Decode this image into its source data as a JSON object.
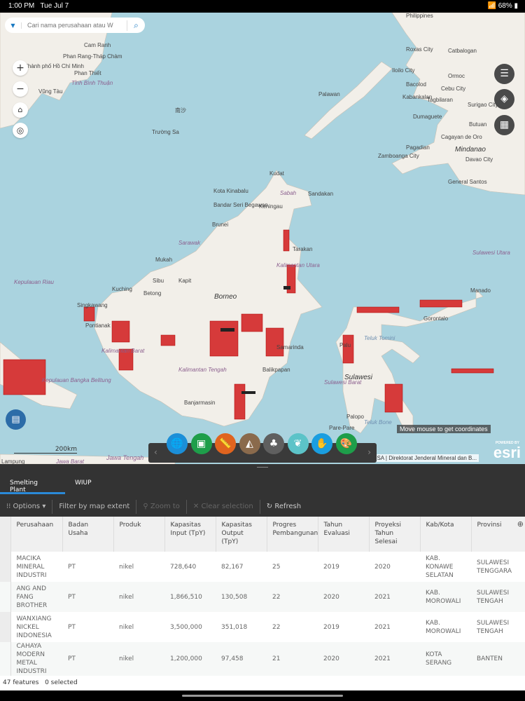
{
  "status": {
    "time": "1:00 PM",
    "date": "Tue Jul 7",
    "battery": "68%"
  },
  "search": {
    "placeholder": "Cari nama perusahaan atau W"
  },
  "map": {
    "labels": {
      "philippines": "Philippines",
      "roxas": "Roxas City",
      "cataloban": "Catbalogan",
      "iloilo": "Iloilo City",
      "bacolod": "Bacolod",
      "cebu": "Cebu City",
      "ormoc": "Ormoc",
      "tagbilaran": "Tagbilaran",
      "surigao": "Surigao City",
      "dumaguete": "Dumaguete",
      "butuan": "Butuan",
      "kabankalan": "Kabankalan",
      "zamboanga": "Zamboanga City",
      "pagadian": "Pagadian",
      "cagayan": "Cagayan de Oro",
      "mindanao": "Mindanao",
      "davao": "Davao City",
      "gensan": "General Santos",
      "palawan": "Palawan",
      "kudat": "Kudat",
      "kk": "Kota Kinabalu",
      "sabah": "Sabah",
      "sandakan": "Sandakan",
      "bsb": "Bandar Seri Begawan",
      "brunei": "Brunei",
      "keningau": "Keningau",
      "tarakan": "Tarakan",
      "mukah": "Mukah",
      "sarawak": "Sarawak",
      "sibu": "Sibu",
      "kapit": "Kapit",
      "borneo": "Borneo",
      "kuching": "Kuching",
      "betong": "Betong",
      "singkawang": "Singkawang",
      "pontianak": "Pontianak",
      "samarinda": "Samarinda",
      "balikpapan": "Balikpapan",
      "banjarmasin": "Banjarmasin",
      "manado": "Manado",
      "gorontalo": "Gorontalo",
      "palu": "Palu",
      "sulawesi": "Sulawesi",
      "parepare": "Pare-Pare",
      "palopo": "Palopo",
      "kepriau": "Kepulauan Riau",
      "camranh": "Cam Ranh",
      "phanrang": "Phan Rang-Tháp Chàm",
      "hcm": "Thành phố Hồ Chí Minh",
      "phanthiet": "Phan Thiết",
      "vungtau": "Vũng Tàu",
      "binhthuan": "Tỉnh Bình Thuận",
      "truongsa": "Trường Sa",
      "kalbar": "Kalimantan Barat",
      "kalteng": "Kalimantan Tengah",
      "kaltim": "Kalimantan Utara",
      "sulbar": "Sulawesi Barat",
      "sulut": "Sulawesi Utara",
      "tomini": "Teluk Tomini",
      "bone": "Teluk Bone",
      "kepbangka": "Kepulauan Bangka Belitung",
      "lampung": "Lampung",
      "jabar": "Jawa Barat",
      "jateng": "Jawa Tengah",
      "nansha": "南沙"
    },
    "scale": "200km",
    "coords": "Move mouse to get coordinates",
    "attribution": "Map data © OpenStreetMap contributors, CC-BY-SA | Direktorat Jenderal Mineral dan B...",
    "esri": "esri",
    "powered": "POWERED BY"
  },
  "toolbar": {
    "tools": [
      {
        "name": "basemap-globe",
        "color": "#1b8fd8",
        "glyph": "🌐"
      },
      {
        "name": "add-data",
        "color": "#1e9e4a",
        "glyph": "▣"
      },
      {
        "name": "measure",
        "color": "#e0641f",
        "glyph": "📏"
      },
      {
        "name": "map-pin-area",
        "color": "#8a6a4c",
        "glyph": "◭"
      },
      {
        "name": "forest",
        "color": "#5f5f5f",
        "glyph": "♣"
      },
      {
        "name": "leaf",
        "color": "#5cc3c8",
        "glyph": "❦"
      },
      {
        "name": "map-hand",
        "color": "#1a9ee0",
        "glyph": "✋"
      },
      {
        "name": "palette",
        "color": "#1e9e4a",
        "glyph": "🎨"
      }
    ]
  },
  "panel": {
    "tabs": [
      "Smelting Plant",
      "WIUP"
    ],
    "options": "Options",
    "filter": "Filter by map extent",
    "zoom": "Zoom to",
    "clear": "Clear selection",
    "refresh": "Refresh"
  },
  "table": {
    "headers": [
      "Perusahaan",
      "Badan Usaha",
      "Produk",
      "Kapasitas Input (TpY)",
      "Kapasitas Output (TpY)",
      "Progres Pembangunan",
      "Tahun Evaluasi",
      "Proyeksi Tahun Selesai",
      "Kab/Kota",
      "Provinsi"
    ],
    "rows": [
      [
        "MACIKA MINERAL INDUSTRI",
        "PT",
        "nikel",
        "728,640",
        "82,167",
        "25",
        "2019",
        "2020",
        "KAB. KONAWE SELATAN",
        "SULAWESI TENGGARA"
      ],
      [
        "ANG AND FANG BROTHER",
        "PT",
        "nikel",
        "1,866,510",
        "130,508",
        "22",
        "2020",
        "2021",
        "KAB. MOROWALI",
        "SULAWESI TENGAH"
      ],
      [
        "WANXIANG NICKEL INDONESIA",
        "PT",
        "nikel",
        "3,500,000",
        "351,018",
        "22",
        "2019",
        "2021",
        "KAB. MOROWALI",
        "SULAWESI TENGAH"
      ],
      [
        "CAHAYA MODERN METAL INDUSTRI",
        "PT",
        "nikel",
        "1,200,000",
        "97,458",
        "21",
        "2020",
        "2021",
        "KOTA SERANG",
        "BANTEN"
      ]
    ]
  },
  "footer": {
    "features": "47 features",
    "selected": "0 selected"
  }
}
